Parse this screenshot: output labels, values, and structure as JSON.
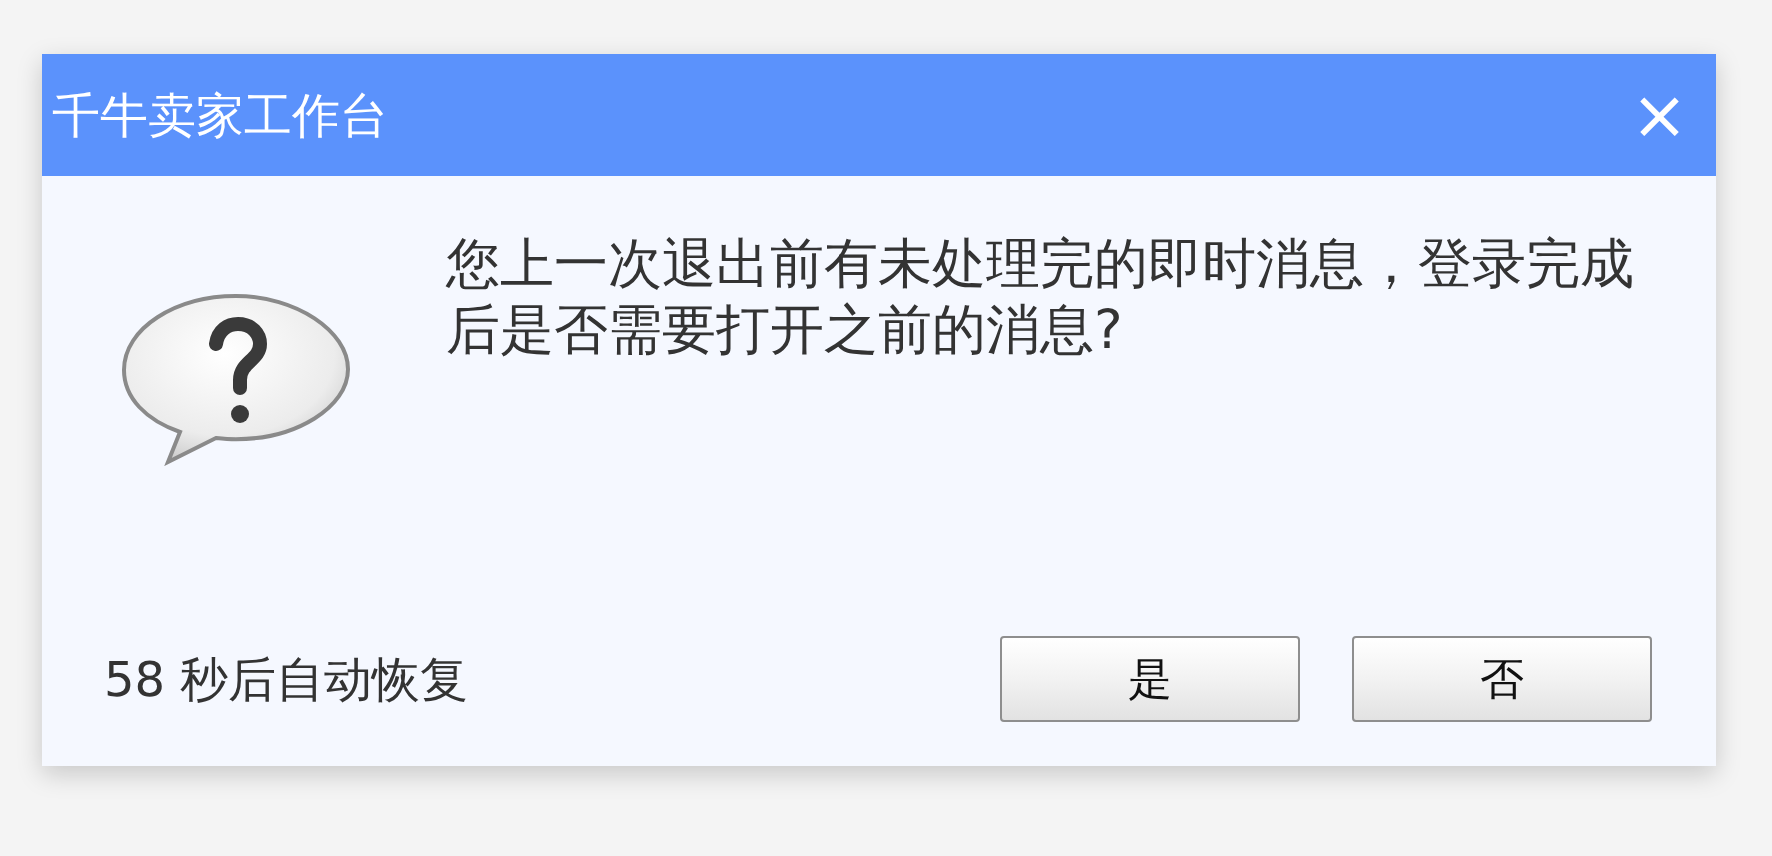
{
  "window": {
    "title": "千牛卖家工作台",
    "close": "×"
  },
  "message": "您上一次退出前有未处理完的即时消息，登录完成后是否需要打开之前的消息?",
  "countdown": "58 秒后自动恢复",
  "buttons": [
    "是",
    "否"
  ]
}
